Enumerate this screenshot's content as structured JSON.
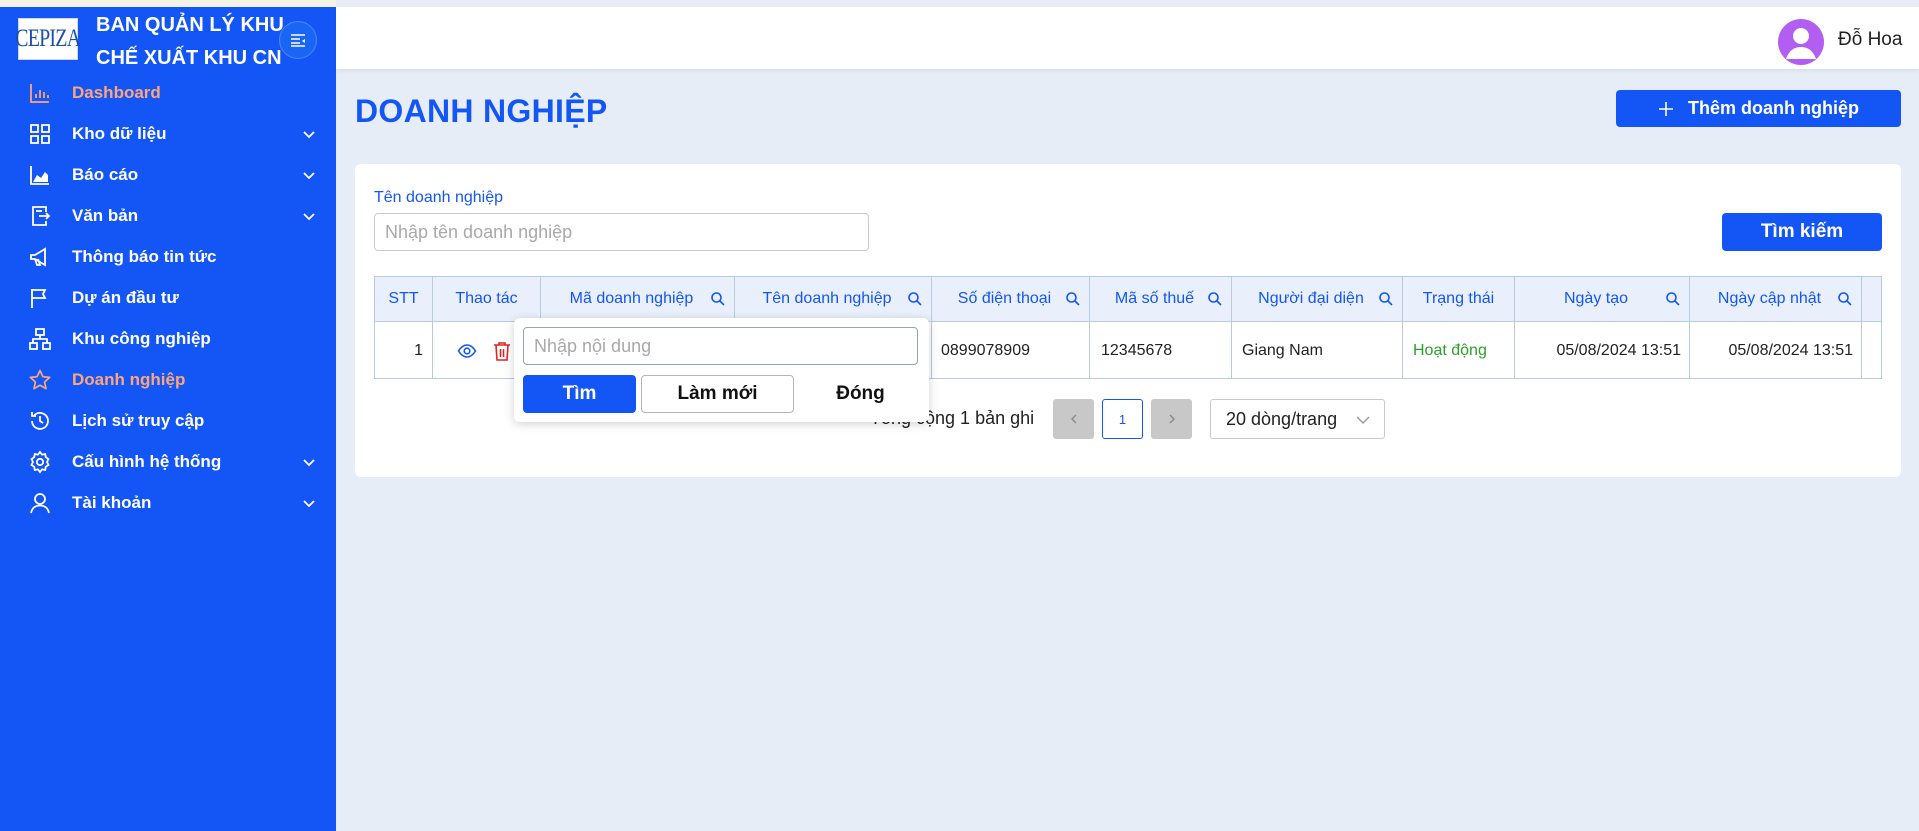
{
  "brand": {
    "logo_text": "CEPIZA",
    "org_line1": "BAN QUẢN LÝ KHU",
    "org_line2": "CHẾ XUẤT KHU CN"
  },
  "sidebar": {
    "items": [
      {
        "label": "Dashboard",
        "icon": "bar-chart-icon",
        "active": true,
        "has_submenu": false
      },
      {
        "label": "Kho dữ liệu",
        "icon": "grid-icon",
        "active": false,
        "has_submenu": true
      },
      {
        "label": "Báo cáo",
        "icon": "area-chart-icon",
        "active": false,
        "has_submenu": true
      },
      {
        "label": "Văn bản",
        "icon": "document-export-icon",
        "active": false,
        "has_submenu": true
      },
      {
        "label": "Thông báo tin tức",
        "icon": "megaphone-icon",
        "active": false,
        "has_submenu": false
      },
      {
        "label": "Dự án đầu tư",
        "icon": "flag-icon",
        "active": false,
        "has_submenu": false
      },
      {
        "label": "Khu công nghiệp",
        "icon": "cluster-icon",
        "active": false,
        "has_submenu": false
      },
      {
        "label": "Doanh nghiệp",
        "icon": "star-icon",
        "active": true,
        "has_submenu": false
      },
      {
        "label": "Lịch sử truy cập",
        "icon": "history-icon",
        "active": false,
        "has_submenu": false
      },
      {
        "label": "Cấu hình hệ thống",
        "icon": "gear-icon",
        "active": false,
        "has_submenu": true
      },
      {
        "label": "Tài khoản",
        "icon": "user-icon",
        "active": false,
        "has_submenu": true
      }
    ]
  },
  "header": {
    "username": "Đỗ Hoa"
  },
  "page": {
    "title": "DOANH NGHIỆP",
    "add_button": "Thêm doanh nghiệp",
    "search_label": "Tên doanh nghiệp",
    "search_placeholder": "Nhập tên doanh nghiệp",
    "search_button": "Tìm kiếm"
  },
  "table": {
    "columns": [
      "STT",
      "Thao tác",
      "Mã doanh nghiệp",
      "Tên doanh nghiệp",
      "Số điện thoại",
      "Mã số thuế",
      "Người đại diện",
      "Trạng thái",
      "Ngày tạo",
      "Ngày cập nhật"
    ],
    "rows": [
      {
        "stt": "1",
        "phone": "0899078909",
        "tax_code": "12345678",
        "representative": "Giang Nam",
        "status": "Hoạt động",
        "created": "05/08/2024 13:51",
        "updated": "05/08/2024 13:51"
      }
    ]
  },
  "pagination": {
    "total_text": "Tổng cộng 1 bản ghi",
    "current_page": "1",
    "page_size": "20 dòng/trang"
  },
  "popover": {
    "placeholder": "Nhập nội dung",
    "find": "Tìm",
    "reset": "Làm mới",
    "close": "Đóng"
  },
  "colors": {
    "primary": "#1456f5",
    "active_menu": "#ffa57a",
    "status_active": "#2ca02c",
    "delete": "#e02424"
  }
}
